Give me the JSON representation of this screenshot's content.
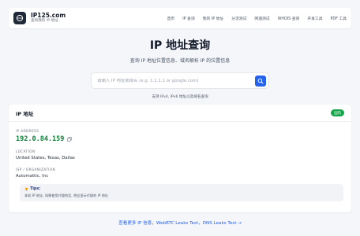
{
  "header": {
    "brand_title": "IP125.com",
    "brand_sub": "查询我的 IP 地址",
    "nav": [
      "首页",
      "IP 查询",
      "我的 IP 地址",
      "分流测试",
      "网速测试",
      "WHOIS 查询",
      "开发工具",
      "PDF 工具"
    ]
  },
  "hero": {
    "title": "IP 地址查询",
    "subtitle": "查询 IP 地址位置信息、域名解析 IP 的位置信息"
  },
  "search": {
    "placeholder": "请输入 IP 地址或域名 (e.g. 1.1.1.1 or google.com)",
    "value": ""
  },
  "hint": "支持 IPv4, IPv6 地址以及域名查询",
  "card": {
    "title": "IP 地址",
    "badge": "国内",
    "ip_label": "IP ADDRESS",
    "ip_value": "192.0.84.159",
    "location_label": "LOCATION",
    "location_value": "United States, Texas, Dallas",
    "isp_label": "ISP / ORGANIZATION",
    "isp_value": "Automattic, Inc",
    "tip_title": "Tips:",
    "tip_text": "本机 IP 地址, 如果使用代理的话, 将会显示代理的 IP 地址"
  },
  "footer": {
    "link": "查看更多 IP 信息，WebRTC Leaks Test，DNS Leaks Test →"
  },
  "colors": {
    "accent": "#2563eb",
    "ip_green": "#15803d",
    "badge_green": "#16a34a"
  }
}
